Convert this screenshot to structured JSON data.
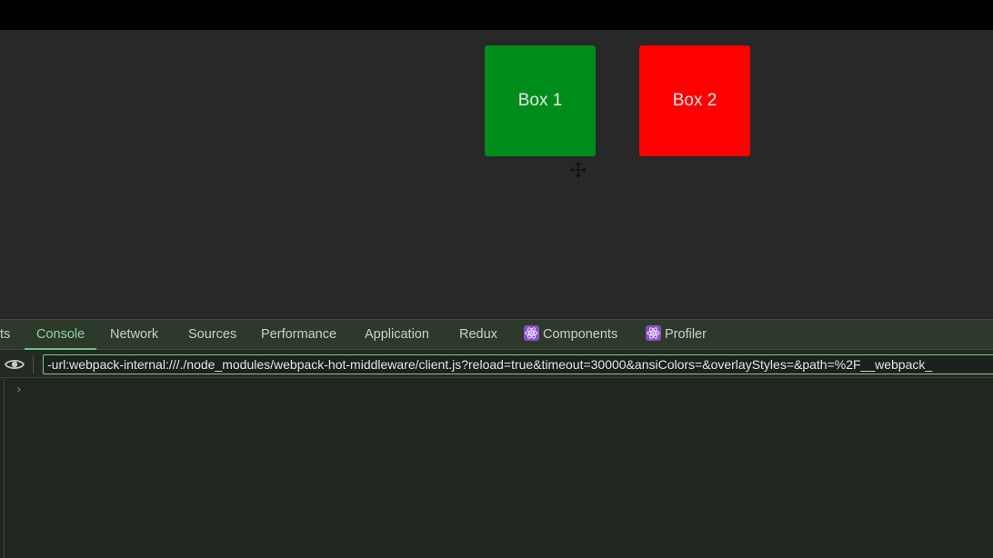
{
  "page": {
    "boxes": [
      {
        "label": "Box 1",
        "color": "#008c1a"
      },
      {
        "label": "Box 2",
        "color": "#ff0000"
      }
    ],
    "cursor_icon": "move-cursor-icon"
  },
  "devtools": {
    "tabs": [
      {
        "label": "ts",
        "active": false
      },
      {
        "label": "Console",
        "active": true
      },
      {
        "label": "Network",
        "active": false
      },
      {
        "label": "Sources",
        "active": false
      },
      {
        "label": "Performance",
        "active": false
      },
      {
        "label": "Application",
        "active": false
      },
      {
        "label": "Redux",
        "active": false
      },
      {
        "label": "Components",
        "active": false,
        "icon": "react-icon"
      },
      {
        "label": "Profiler",
        "active": false,
        "icon": "react-icon"
      }
    ],
    "filter": {
      "value": "-url:webpack-internal:///./node_modules/webpack-hot-middleware/client.js?reload=true&timeout=30000&ansiColors=&overlayStyles=&path=%2F__webpack_",
      "icon": "eye-icon"
    },
    "console": {
      "prompt_symbol": "›"
    },
    "colors": {
      "active_tab": "#8fd1a0",
      "filter_border": "#7fc98f"
    }
  }
}
